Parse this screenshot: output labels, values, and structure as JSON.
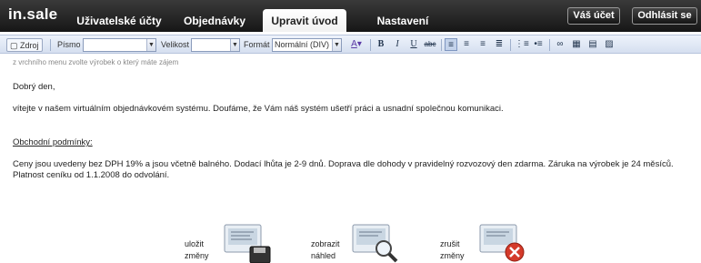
{
  "app": {
    "logo": "in.sale"
  },
  "nav": {
    "tabs": [
      {
        "label": "Uživatelské účty"
      },
      {
        "label": "Objednávky"
      },
      {
        "label": "Upravit úvod"
      },
      {
        "label": "Nastavení"
      }
    ],
    "active_tab": "Upravit úvod",
    "account_label": "Váš účet",
    "logout_label": "Odhlásit se"
  },
  "toolbar": {
    "source_label": "Zdroj",
    "font_label": "Písmo",
    "size_label": "Velikost",
    "format_label": "Formát",
    "format_value": "Normální (DIV)",
    "font_value": "",
    "size_value": ""
  },
  "content": {
    "hint": "z vrchního menu zvolte výrobek o který máte zájem",
    "greeting": "Dobrý den,",
    "welcome": "vítejte v našem virtuálním objednávkovém systému. Doufáme, že Vám náš systém ušetří práci a usnadní společnou komunikaci.",
    "terms_heading": "Obchodní podmínky:",
    "terms_line1": "Ceny jsou uvedeny bez DPH 19% a jsou včetně balného. Dodací lhůta je 2-9 dnů. Doprava dle dohody v pravidelný rozvozový den zdarma. Záruka na výrobek je 24 měsíců.",
    "terms_line2": "Platnost ceníku od 1.1.2008 do odvolání."
  },
  "actions": [
    {
      "line1": "uložit",
      "line2": "změny",
      "icon": "save-disk-icon"
    },
    {
      "line1": "zobrazit",
      "line2": "náhled",
      "icon": "magnifier-icon"
    },
    {
      "line1": "zrušit",
      "line2": "změny",
      "icon": "cancel-icon"
    }
  ],
  "colors": {
    "topbar": "#1e1e1e",
    "toolbar": "#dfe7f4",
    "cancel_red": "#d43a2a"
  }
}
